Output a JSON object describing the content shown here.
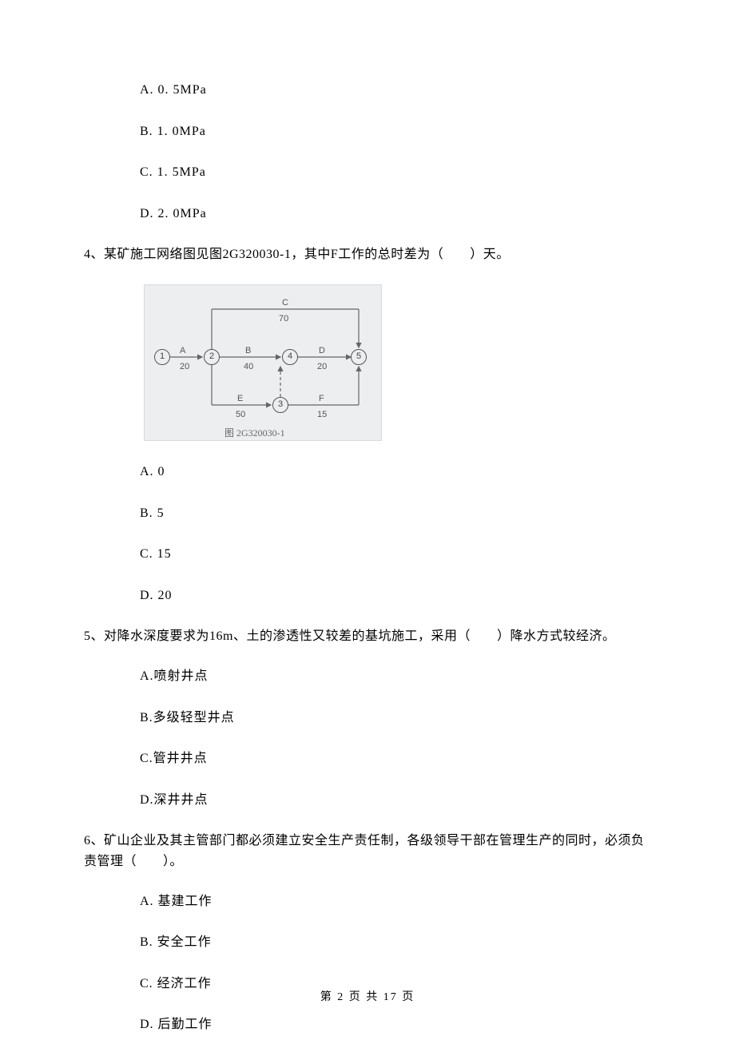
{
  "q3_tail": {
    "options": {
      "A": "A. 0. 5MPa",
      "B": "B. 1. 0MPa",
      "C": "C. 1. 5MPa",
      "D": "D. 2. 0MPa"
    }
  },
  "q4": {
    "text": "4、某矿施工网络图见图2G320030-1，其中F工作的总时差为（　　）天。",
    "options": {
      "A": "A. 0",
      "B": "B. 5",
      "C": "C. 15",
      "D": "D. 20"
    }
  },
  "q5": {
    "text": "5、对降水深度要求为16m、土的渗透性又较差的基坑施工，采用（　　）降水方式较经济。",
    "options": {
      "A": "A.喷射井点",
      "B": "B.多级轻型井点",
      "C": "C.管井井点",
      "D": "D.深井井点"
    }
  },
  "q6": {
    "text": "6、矿山企业及其主管部门都必须建立安全生产责任制，各级领导干部在管理生产的同时，必须负责管理（　　）。",
    "options": {
      "A": "A. 基建工作",
      "B": "B. 安全工作",
      "C": "C. 经济工作",
      "D": "D. 后勤工作"
    }
  },
  "diagram": {
    "caption": "图 2G320030-1",
    "nodes": {
      "n1": "1",
      "n2": "2",
      "n3": "3",
      "n4": "4",
      "n5": "5"
    },
    "activities": {
      "A": {
        "label": "A",
        "dur": "20"
      },
      "B": {
        "label": "B",
        "dur": "40"
      },
      "C": {
        "label": "C",
        "dur": "70"
      },
      "D": {
        "label": "D",
        "dur": "20"
      },
      "E": {
        "label": "E",
        "dur": "50"
      },
      "F": {
        "label": "F",
        "dur": "15"
      }
    }
  },
  "chart_data": {
    "type": "network-diagram",
    "title": "图 2G320030-1",
    "nodes": [
      1,
      2,
      3,
      4,
      5
    ],
    "activities": [
      {
        "name": "A",
        "from": 1,
        "to": 2,
        "duration": 20
      },
      {
        "name": "B",
        "from": 2,
        "to": 4,
        "duration": 40
      },
      {
        "name": "C",
        "from": 2,
        "to": 5,
        "duration": 70
      },
      {
        "name": "D",
        "from": 4,
        "to": 5,
        "duration": 20
      },
      {
        "name": "E",
        "from": 2,
        "to": 3,
        "duration": 50
      },
      {
        "name": "F",
        "from": 3,
        "to": 5,
        "duration": 15
      },
      {
        "name": "dummy",
        "from": 3,
        "to": 4,
        "duration": 0
      }
    ]
  },
  "pager": "第 2 页 共 17 页"
}
